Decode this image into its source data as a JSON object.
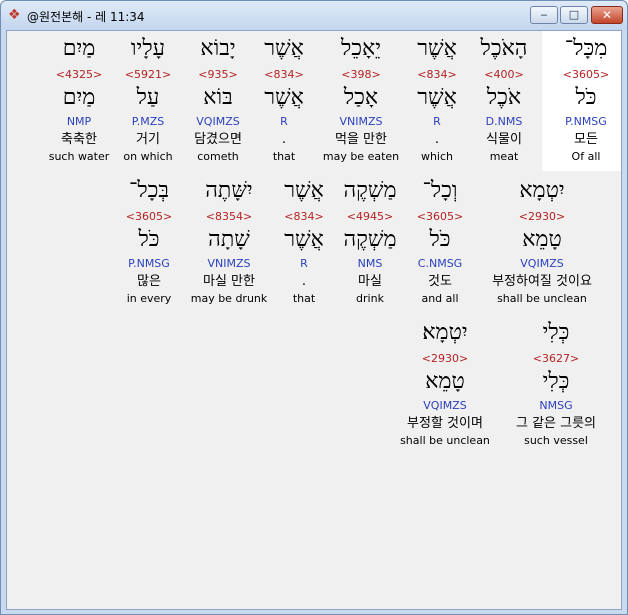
{
  "window": {
    "title": "@원전본해 - 레 11:34",
    "min_label": "‒",
    "max_label": "□",
    "close_label": "✕"
  },
  "rows": [
    {
      "words": [
        {
          "hebrew": "מִכָּל־",
          "strong": "<3605>",
          "root": "כֹּל",
          "morph": "P.NMSG",
          "korean": "모든",
          "english": "Of all",
          "highlight": true
        },
        {
          "hebrew": "הָאֹכֶל",
          "strong": "<400>",
          "root": "אֹכֶל",
          "morph": "D.NMS",
          "korean": "식물이",
          "english": "meat"
        },
        {
          "hebrew": "אֲשֶׁר",
          "strong": "<834>",
          "root": "אֲשֶׁר",
          "morph": "R",
          "korean": ".",
          "english": "which"
        },
        {
          "hebrew": "יֵאָכֵל",
          "strong": "<398>",
          "root": "אָכַל",
          "morph": "VNIMZS",
          "korean": "먹을 만한",
          "english": "may be eaten"
        },
        {
          "hebrew": "אֲשֶׁר",
          "strong": "<834>",
          "root": "אֲשֶׁר",
          "morph": "R",
          "korean": ".",
          "english": "that"
        },
        {
          "hebrew": "יָבוֹא",
          "strong": "<935>",
          "root": "בּוֹא",
          "morph": "VQIMZS",
          "korean": "담겼으면",
          "english": "cometh"
        },
        {
          "hebrew": "עָלָיו",
          "strong": "<5921>",
          "root": "עַל",
          "morph": "P.MZS",
          "korean": "거기",
          "english": "on which"
        },
        {
          "hebrew": "מַיִם",
          "strong": "<4325>",
          "root": "מַיִם",
          "morph": "NMP",
          "korean": "축축한",
          "english": "such water"
        }
      ]
    },
    {
      "words": [
        {
          "hebrew": "יִטְמָא",
          "strong": "<2930>",
          "root": "טָמֵא",
          "morph": "VQIMZS",
          "korean": "부정하여질 것이요",
          "english": "shall be unclean"
        },
        {
          "hebrew": "וְכָל־",
          "strong": "<3605>",
          "root": "כֹּל",
          "morph": "C.NMSG",
          "korean": "것도",
          "english": "and all"
        },
        {
          "hebrew": "מַשְׁקֶה",
          "strong": "<4945>",
          "root": "מַשְׁקֶה",
          "morph": "NMS",
          "korean": "마실",
          "english": "drink"
        },
        {
          "hebrew": "אֲשֶׁר",
          "strong": "<834>",
          "root": "אֲשֶׁר",
          "morph": "R",
          "korean": ".",
          "english": "that"
        },
        {
          "hebrew": "יִשָּׁתֶה",
          "strong": "<8354>",
          "root": "שָׁתָה",
          "morph": "VNIMZS",
          "korean": "마실 만한",
          "english": "may be drunk"
        },
        {
          "hebrew": "בְּכָל־",
          "strong": "<3605>",
          "root": "כֹּל",
          "morph": "P.NMSG",
          "korean": "많은",
          "english": "in every"
        }
      ]
    },
    {
      "words": [
        {
          "hebrew": "כְּלִי",
          "strong": "<3627>",
          "root": "כְּלִי",
          "morph": "NMSG",
          "korean": "그 같은 그릇의",
          "english": "such vessel"
        },
        {
          "hebrew": "יִטְמָא׃",
          "strong": "<2930>",
          "root": "טָמֵא",
          "morph": "VQIMZS",
          "korean": "부정할 것이며",
          "english": "shall be unclean"
        }
      ]
    }
  ]
}
